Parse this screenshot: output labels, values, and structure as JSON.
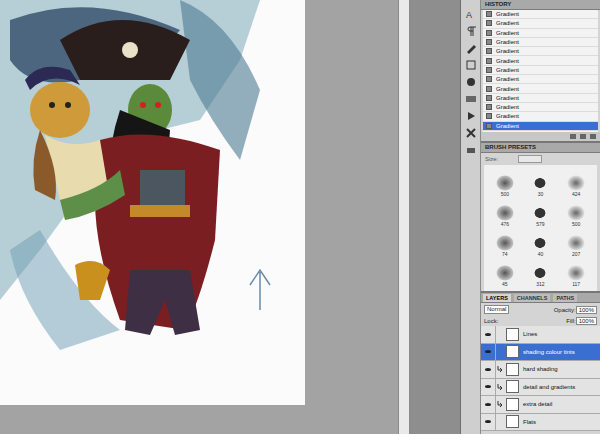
{
  "history": {
    "title": "HISTORY",
    "items": [
      {
        "label": "Gradient",
        "selected": false
      },
      {
        "label": "Gradient",
        "selected": false
      },
      {
        "label": "Gradient",
        "selected": false
      },
      {
        "label": "Gradient",
        "selected": false
      },
      {
        "label": "Gradient",
        "selected": false
      },
      {
        "label": "Gradient",
        "selected": false
      },
      {
        "label": "Gradient",
        "selected": false
      },
      {
        "label": "Gradient",
        "selected": false
      },
      {
        "label": "Gradient",
        "selected": false
      },
      {
        "label": "Gradient",
        "selected": false
      },
      {
        "label": "Gradient",
        "selected": false
      },
      {
        "label": "Gradient",
        "selected": false
      },
      {
        "label": "Gradient",
        "selected": true
      }
    ]
  },
  "brushes": {
    "title": "BRUSH PRESETS",
    "size_label": "Size:",
    "presets": [
      {
        "size": "500"
      },
      {
        "size": "30"
      },
      {
        "size": "424"
      },
      {
        "size": "476"
      },
      {
        "size": "579"
      },
      {
        "size": "500"
      },
      {
        "size": "74"
      },
      {
        "size": "40"
      },
      {
        "size": "207"
      },
      {
        "size": "45"
      },
      {
        "size": "312"
      },
      {
        "size": "117"
      }
    ]
  },
  "layers": {
    "tabs": [
      {
        "label": "LAYERS",
        "selected": true
      },
      {
        "label": "CHANNELS",
        "selected": false
      },
      {
        "label": "PATHS",
        "selected": false
      }
    ],
    "blend_mode": "Normal",
    "opacity_label": "Opacity:",
    "opacity": "100%",
    "lock_label": "Lock:",
    "fill_label": "Fill:",
    "fill": "100%",
    "items": [
      {
        "name": "Lines",
        "visible": true,
        "clipped": false,
        "selected": false
      },
      {
        "name": "shading colour tints",
        "visible": true,
        "clipped": false,
        "selected": true
      },
      {
        "name": "hard shading",
        "visible": true,
        "clipped": true,
        "selected": false
      },
      {
        "name": "detail and gradients",
        "visible": true,
        "clipped": true,
        "selected": false
      },
      {
        "name": "extra detail",
        "visible": true,
        "clipped": true,
        "selected": false
      },
      {
        "name": "Flats",
        "visible": true,
        "clipped": false,
        "selected": false
      }
    ]
  }
}
